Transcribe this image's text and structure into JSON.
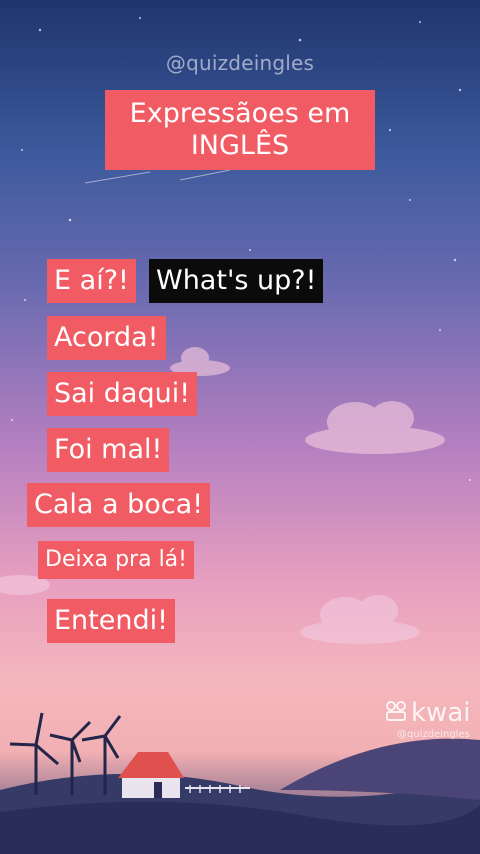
{
  "handle": "@quizdeingles",
  "title": {
    "line1": "Expressãoes em",
    "line2": "INGLÊS"
  },
  "phrases": [
    {
      "text": "E aí?!"
    },
    {
      "text": "What's up?!"
    },
    {
      "text": "Acorda!"
    },
    {
      "text": "Sai daqui!"
    },
    {
      "text": "Foi mal!"
    },
    {
      "text": "Cala a boca!"
    },
    {
      "text": "Deixa pra lá!"
    },
    {
      "text": "Entendi!"
    }
  ],
  "watermark": {
    "brand": "kwai",
    "user": "@quizdeingles"
  },
  "colors": {
    "tag": "#f15b63",
    "answer_tag": "#0b0b0b"
  }
}
